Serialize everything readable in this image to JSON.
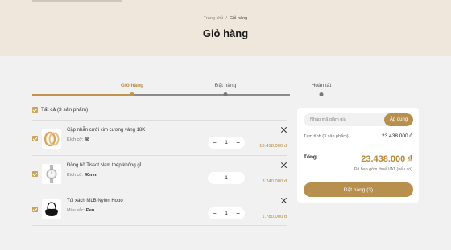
{
  "breadcrumb": {
    "home": "Trang chủ",
    "separator": "/",
    "current": "Giỏ hàng"
  },
  "page_title": "Giỏ hàng",
  "steps": [
    {
      "label": "Giỏ hàng",
      "active": true
    },
    {
      "label": "Đặt hàng",
      "active": false
    },
    {
      "label": "Hoàn tất",
      "active": false
    }
  ],
  "select_all_label": "Tất cả (3 sản phẩm)",
  "items": [
    {
      "name": "Cặp nhẫn cưới kim cương vàng 18K",
      "meta_label": "Kích cỡ:",
      "meta_value": "48",
      "qty": "1",
      "price": "18.418.000 đ",
      "icon": "rings-icon"
    },
    {
      "name": "Đồng hồ Tissot Nam thép không gỉ",
      "meta_label": "Kích cỡ:",
      "meta_value": "40mm",
      "qty": "1",
      "price": "3.240.000 đ",
      "icon": "watch-icon"
    },
    {
      "name": "Túi xách MLB Nylon Hobo",
      "meta_label": "Màu sắc:",
      "meta_value": "Đen",
      "qty": "1",
      "price": "1.780.000 đ",
      "icon": "handbag-icon"
    }
  ],
  "stepper": {
    "minus": "−",
    "plus": "+"
  },
  "summary": {
    "coupon_placeholder": "Nhập mã giảm giá",
    "coupon_button": "Áp dụng",
    "subtotal_label": "Tạm tính (3 sản phẩm)",
    "subtotal_value": "23.438.000 đ",
    "total_label": "Tổng",
    "total_value": "23.438.000 ₫",
    "vat_note": "Đã bao gồm thuế VAT (nếu có)",
    "checkout_button": "Đặt hàng (3)"
  },
  "colors": {
    "accent": "#b79050",
    "hero_bg": "#efe7dc",
    "page_bg": "#f1f1f1"
  }
}
